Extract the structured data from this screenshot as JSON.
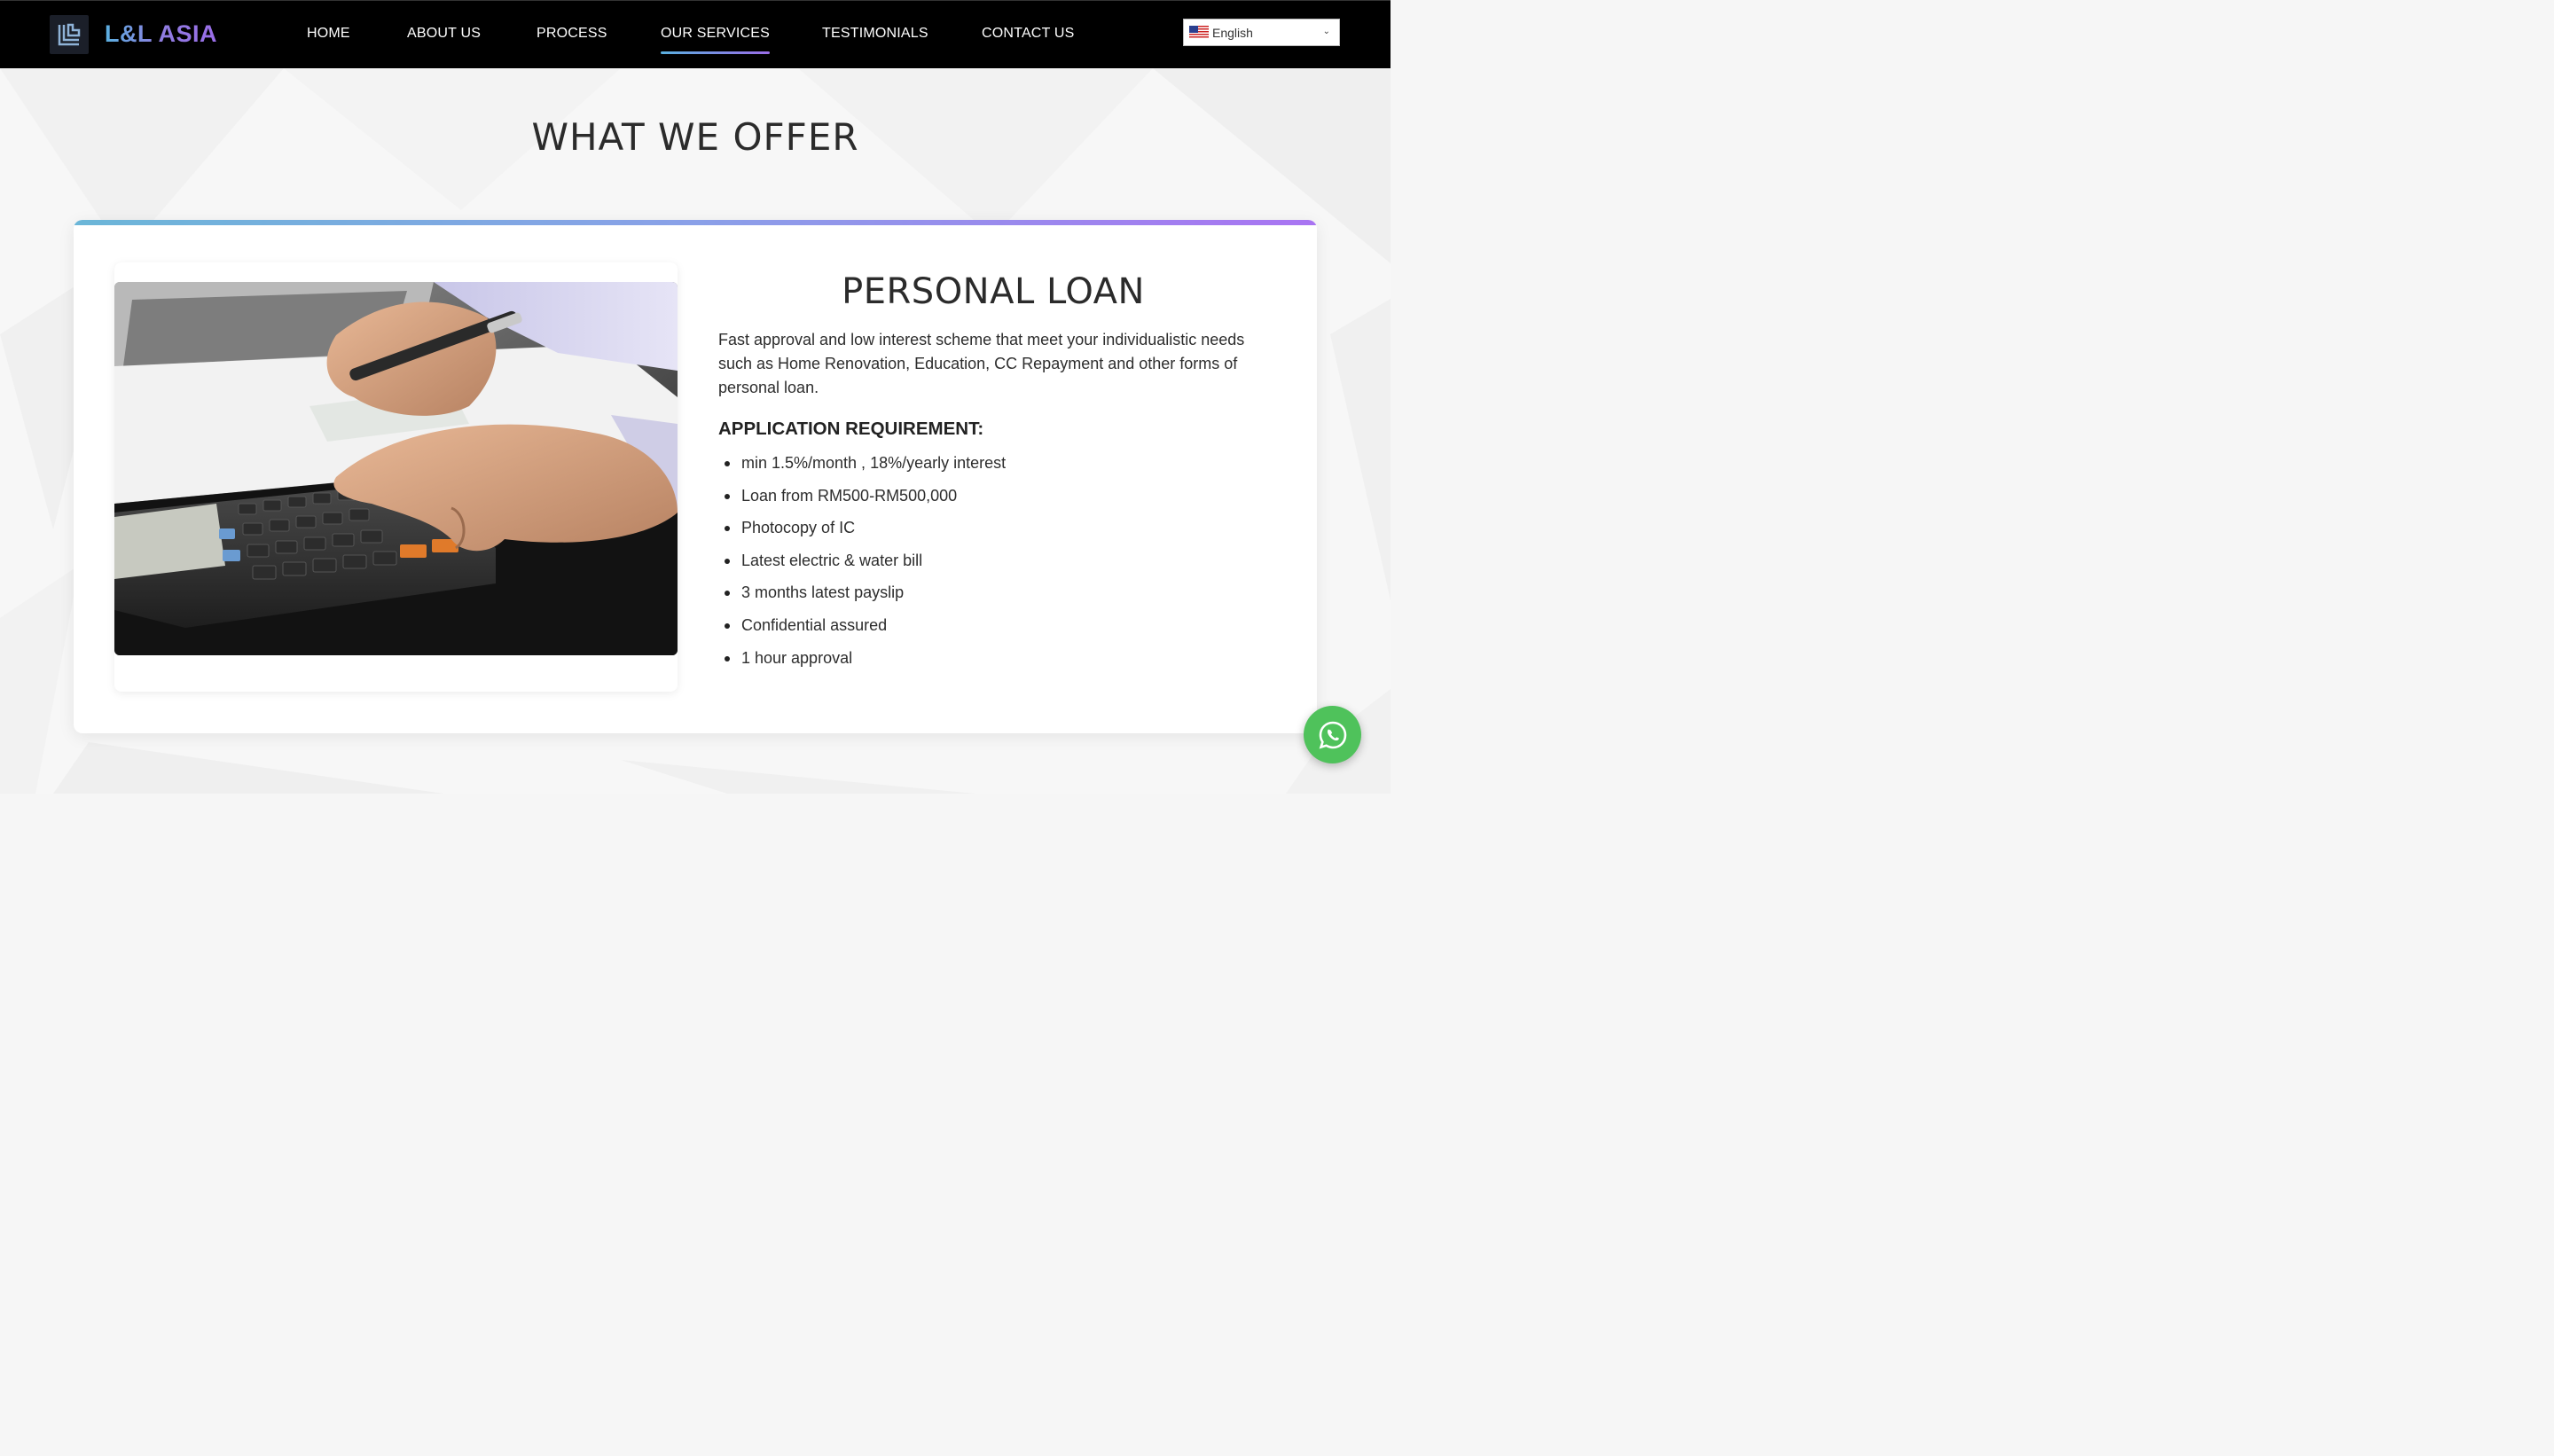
{
  "brand": {
    "name": "L&L ASIA",
    "logo_icon": "ll-logo-icon"
  },
  "nav": {
    "items": [
      {
        "label": "HOME",
        "active": false
      },
      {
        "label": "ABOUT US",
        "active": false
      },
      {
        "label": "PROCESS",
        "active": false
      },
      {
        "label": "OUR SERVICES",
        "active": true
      },
      {
        "label": "TESTIMONIALS",
        "active": false
      },
      {
        "label": "CONTACT US",
        "active": false
      }
    ]
  },
  "language": {
    "selected": "English",
    "flag_icon": "us-flag-icon"
  },
  "section": {
    "title": "WHAT WE OFFER"
  },
  "service": {
    "title": "PERSONAL LOAN",
    "description": "Fast approval and low interest scheme that meet your individualistic needs such as Home Renovation, Education, CC Repayment and other forms of personal loan.",
    "requirements_heading": "APPLICATION REQUIREMENT:",
    "requirements": [
      "min 1.5%/month , 18%/yearly interest",
      "Loan from RM500-RM500,000",
      "Photocopy of IC",
      "Latest electric & water bill",
      "3 months latest payslip",
      "Confidential assured",
      "1 hour approval"
    ],
    "image_icon": "calculator-photo"
  },
  "floating": {
    "whatsapp_icon": "whatsapp-icon"
  },
  "colors": {
    "nav_bg": "#000000",
    "accent_start": "#5ab0e0",
    "accent_end": "#9a6de8",
    "whatsapp": "#4fc25b"
  }
}
